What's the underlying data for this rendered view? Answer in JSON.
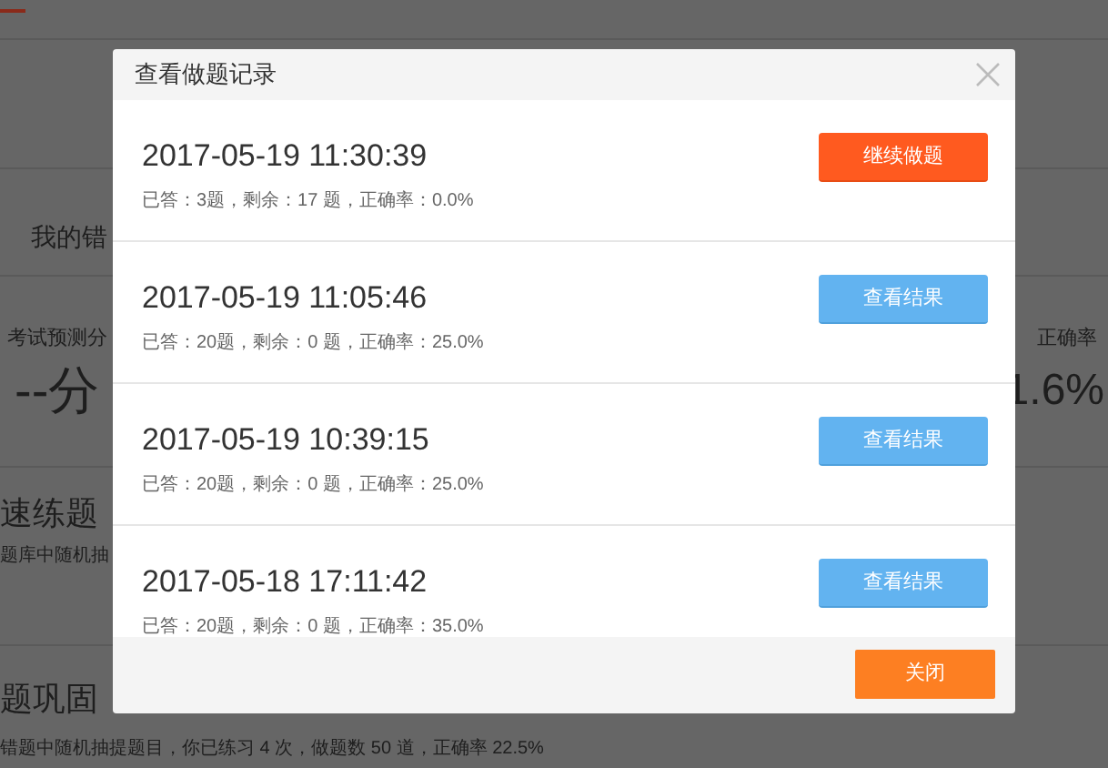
{
  "background": {
    "section_title": "我的错",
    "stats": {
      "left_label": "考试预测分",
      "left_value": "--分",
      "right_label": "正确率",
      "right_value": "1.6%"
    },
    "practice": {
      "title": "速练题",
      "description": "题库中随机抽"
    },
    "review": {
      "title": "题巩固",
      "description": "错题中随机抽提题目，你已练习 4 次，做题数 50 道，正确率 22.5%"
    }
  },
  "dialog": {
    "title": "查看做题记录",
    "records": [
      {
        "datetime": "2017-05-19 11:30:39",
        "summary": "已答：3题，剩余：17 题，正确率：0.0%",
        "action": {
          "kind": "continue",
          "label": "继续做题"
        }
      },
      {
        "datetime": "2017-05-19 11:05:46",
        "summary": "已答：20题，剩余：0 题，正确率：25.0%",
        "action": {
          "kind": "result",
          "label": "查看结果"
        }
      },
      {
        "datetime": "2017-05-19 10:39:15",
        "summary": "已答：20题，剩余：0 题，正确率：25.0%",
        "action": {
          "kind": "result",
          "label": "查看结果"
        }
      },
      {
        "datetime": "2017-05-18 17:11:42",
        "summary": "已答：20题，剩余：0 题，正确率：35.0%",
        "action": {
          "kind": "result",
          "label": "查看结果"
        }
      }
    ],
    "close_button": "关闭"
  }
}
